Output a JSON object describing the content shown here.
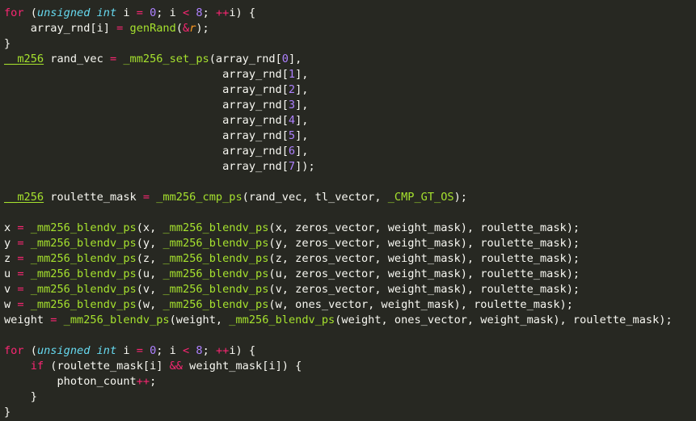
{
  "editor": {
    "colors": {
      "background": "#272822",
      "text": "#f8f8f2",
      "keyword": "#f92672",
      "type": "#66d9ef",
      "number": "#ae81ff",
      "function": "#a6e22e",
      "parameter": "#fd971f"
    },
    "lines": [
      [
        [
          "kw",
          "for"
        ],
        [
          "p",
          " ("
        ],
        [
          "ty",
          "unsigned int"
        ],
        [
          "p",
          " i "
        ],
        [
          "op",
          "="
        ],
        [
          "p",
          " "
        ],
        [
          "num",
          "0"
        ],
        [
          "p",
          "; i "
        ],
        [
          "op",
          "<"
        ],
        [
          "p",
          " "
        ],
        [
          "num",
          "8"
        ],
        [
          "p",
          "; "
        ],
        [
          "op",
          "++"
        ],
        [
          "p",
          "i) {"
        ]
      ],
      [
        [
          "p",
          "    array_rnd[i] "
        ],
        [
          "op",
          "="
        ],
        [
          "p",
          " "
        ],
        [
          "fn",
          "genRand"
        ],
        [
          "p",
          "("
        ],
        [
          "op",
          "&"
        ],
        [
          "it",
          "r"
        ],
        [
          "p",
          ");"
        ]
      ],
      [
        [
          "p",
          "}"
        ]
      ],
      [
        [
          "ul",
          "__m256"
        ],
        [
          "p",
          " rand_vec "
        ],
        [
          "op",
          "="
        ],
        [
          "p",
          " "
        ],
        [
          "fn",
          "_mm256_set_ps"
        ],
        [
          "p",
          "(array_rnd["
        ],
        [
          "num",
          "0"
        ],
        [
          "p",
          "],"
        ]
      ],
      [
        [
          "p",
          "                                 array_rnd["
        ],
        [
          "num",
          "1"
        ],
        [
          "p",
          "],"
        ]
      ],
      [
        [
          "p",
          "                                 array_rnd["
        ],
        [
          "num",
          "2"
        ],
        [
          "p",
          "],"
        ]
      ],
      [
        [
          "p",
          "                                 array_rnd["
        ],
        [
          "num",
          "3"
        ],
        [
          "p",
          "],"
        ]
      ],
      [
        [
          "p",
          "                                 array_rnd["
        ],
        [
          "num",
          "4"
        ],
        [
          "p",
          "],"
        ]
      ],
      [
        [
          "p",
          "                                 array_rnd["
        ],
        [
          "num",
          "5"
        ],
        [
          "p",
          "],"
        ]
      ],
      [
        [
          "p",
          "                                 array_rnd["
        ],
        [
          "num",
          "6"
        ],
        [
          "p",
          "],"
        ]
      ],
      [
        [
          "p",
          "                                 array_rnd["
        ],
        [
          "num",
          "7"
        ],
        [
          "p",
          "]);"
        ]
      ],
      [],
      [
        [
          "ul",
          "__m256"
        ],
        [
          "p",
          " roulette_mask "
        ],
        [
          "op",
          "="
        ],
        [
          "p",
          " "
        ],
        [
          "fn",
          "_mm256_cmp_ps"
        ],
        [
          "p",
          "(rand_vec, tl_vector, "
        ],
        [
          "fn",
          "_CMP_GT_OS"
        ],
        [
          "p",
          ");"
        ]
      ],
      [],
      [
        [
          "p",
          "x "
        ],
        [
          "op",
          "="
        ],
        [
          "p",
          " "
        ],
        [
          "fn",
          "_mm256_blendv_ps"
        ],
        [
          "p",
          "(x, "
        ],
        [
          "fn",
          "_mm256_blendv_ps"
        ],
        [
          "p",
          "(x, zeros_vector, weight_mask), roulette_mask);"
        ]
      ],
      [
        [
          "p",
          "y "
        ],
        [
          "op",
          "="
        ],
        [
          "p",
          " "
        ],
        [
          "fn",
          "_mm256_blendv_ps"
        ],
        [
          "p",
          "(y, "
        ],
        [
          "fn",
          "_mm256_blendv_ps"
        ],
        [
          "p",
          "(y, zeros_vector, weight_mask), roulette_mask);"
        ]
      ],
      [
        [
          "p",
          "z "
        ],
        [
          "op",
          "="
        ],
        [
          "p",
          " "
        ],
        [
          "fn",
          "_mm256_blendv_ps"
        ],
        [
          "p",
          "(z, "
        ],
        [
          "fn",
          "_mm256_blendv_ps"
        ],
        [
          "p",
          "(z, zeros_vector, weight_mask), roulette_mask);"
        ]
      ],
      [
        [
          "p",
          "u "
        ],
        [
          "op",
          "="
        ],
        [
          "p",
          " "
        ],
        [
          "fn",
          "_mm256_blendv_ps"
        ],
        [
          "p",
          "(u, "
        ],
        [
          "fn",
          "_mm256_blendv_ps"
        ],
        [
          "p",
          "(u, zeros_vector, weight_mask), roulette_mask);"
        ]
      ],
      [
        [
          "p",
          "v "
        ],
        [
          "op",
          "="
        ],
        [
          "p",
          " "
        ],
        [
          "fn",
          "_mm256_blendv_ps"
        ],
        [
          "p",
          "(v, "
        ],
        [
          "fn",
          "_mm256_blendv_ps"
        ],
        [
          "p",
          "(v, zeros_vector, weight_mask), roulette_mask);"
        ]
      ],
      [
        [
          "p",
          "w "
        ],
        [
          "op",
          "="
        ],
        [
          "p",
          " "
        ],
        [
          "fn",
          "_mm256_blendv_ps"
        ],
        [
          "p",
          "(w, "
        ],
        [
          "fn",
          "_mm256_blendv_ps"
        ],
        [
          "p",
          "(w, ones_vector, weight_mask), roulette_mask);"
        ]
      ],
      [
        [
          "p",
          "weight "
        ],
        [
          "op",
          "="
        ],
        [
          "p",
          " "
        ],
        [
          "fn",
          "_mm256_blendv_ps"
        ],
        [
          "p",
          "(weight, "
        ],
        [
          "fn",
          "_mm256_blendv_ps"
        ],
        [
          "p",
          "(weight, ones_vector, weight_mask), roulette_mask);"
        ]
      ],
      [],
      [
        [
          "kw",
          "for"
        ],
        [
          "p",
          " ("
        ],
        [
          "ty",
          "unsigned int"
        ],
        [
          "p",
          " i "
        ],
        [
          "op",
          "="
        ],
        [
          "p",
          " "
        ],
        [
          "num",
          "0"
        ],
        [
          "p",
          "; i "
        ],
        [
          "op",
          "<"
        ],
        [
          "p",
          " "
        ],
        [
          "num",
          "8"
        ],
        [
          "p",
          "; "
        ],
        [
          "op",
          "++"
        ],
        [
          "p",
          "i) {"
        ]
      ],
      [
        [
          "p",
          "    "
        ],
        [
          "kw",
          "if"
        ],
        [
          "p",
          " (roulette_mask[i] "
        ],
        [
          "op",
          "&&"
        ],
        [
          "p",
          " weight_mask[i]) {"
        ]
      ],
      [
        [
          "p",
          "        photon_count"
        ],
        [
          "op",
          "++"
        ],
        [
          "p",
          ";"
        ]
      ],
      [
        [
          "p",
          "    }"
        ]
      ],
      [
        [
          "p",
          "}"
        ]
      ]
    ]
  }
}
